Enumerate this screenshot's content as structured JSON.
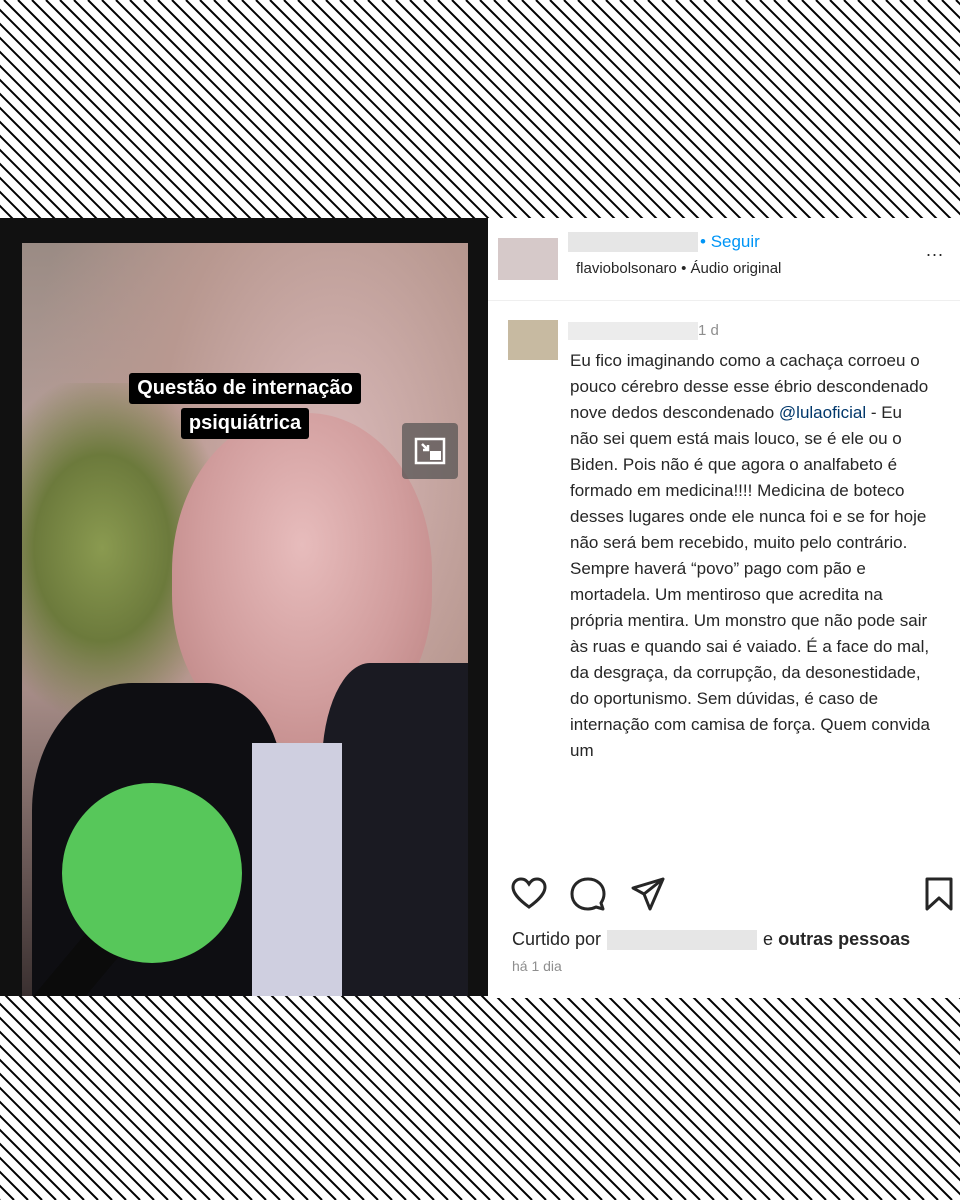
{
  "video": {
    "caption_line1": "Questão de internação",
    "caption_line2": "psiquiátrica"
  },
  "header": {
    "follow_label": "Seguir",
    "separator": "•",
    "meta": "flaviobolsonaro • Áudio original",
    "more": "..."
  },
  "comment": {
    "time": "1 d",
    "text_before": "Eu fico imaginando como a cachaça corroeu o pouco cérebro desse esse ébrio descondenado nove dedos descondenado ",
    "mention": "@lulaoficial",
    "text_after": " - Eu não sei quem está mais louco, se é ele ou o Biden. Pois não é que agora o analfabeto é formado em medicina!!!! Medicina de boteco desses lugares onde ele nunca foi e se for hoje não será bem recebido, muito pelo contrário. Sempre haverá “povo” pago com pão e mortadela. Um mentiroso que acredita na própria mentira. Um monstro que não pode sair às ruas e quando sai é vaiado. É a face do mal, da desgraça, da corrupção, da desonestidade, do oportunismo. Sem dúvidas, é caso de internação com camisa de força. Quem convida um"
  },
  "footer": {
    "liked_prefix": "Curtido por",
    "liked_suffix_connector": "e",
    "liked_suffix": "outras pessoas",
    "time_ago": "há 1 dia"
  },
  "icons": [
    "like-icon",
    "comment-icon",
    "share-icon",
    "save-icon",
    "picture-in-picture-icon"
  ],
  "colors": {
    "link": "#0095f6",
    "mention": "#00376b"
  }
}
